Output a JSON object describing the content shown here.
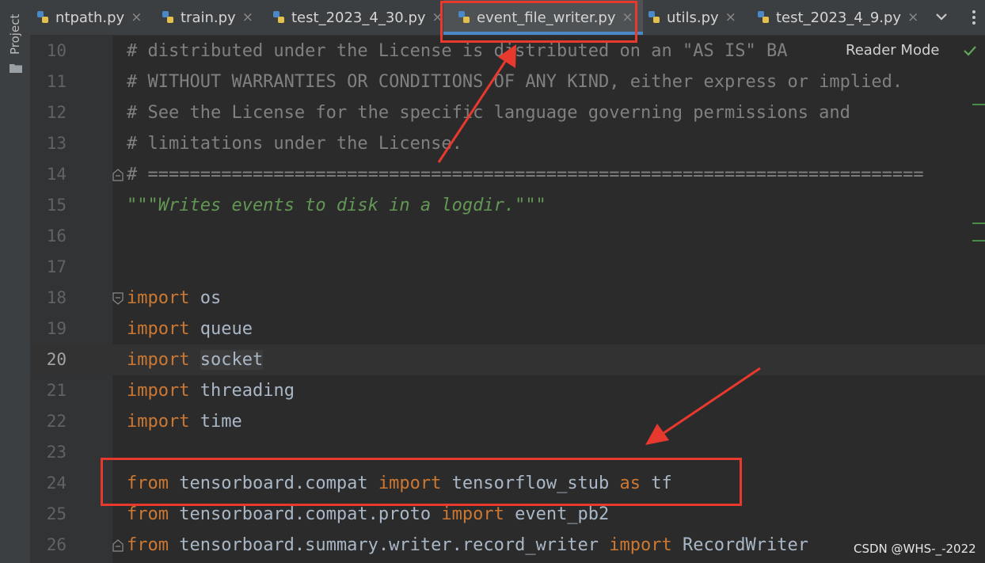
{
  "sidebar": {
    "project_label": "Project",
    "project_icon": "folder-icon"
  },
  "tabs": [
    {
      "label": "ntpath.py",
      "icon": "python-file-icon"
    },
    {
      "label": "train.py",
      "icon": "python-file-icon"
    },
    {
      "label": "test_2023_4_30.py",
      "icon": "python-file-icon"
    },
    {
      "label": "event_file_writer.py",
      "icon": "python-file-icon",
      "active": true
    },
    {
      "label": "utils.py",
      "icon": "python-file-icon"
    },
    {
      "label": "test_2023_4_9.py",
      "icon": "python-file-icon"
    }
  ],
  "tab_close_glyph": "×",
  "editor": {
    "reader_mode_label": "Reader Mode",
    "current_line": "20",
    "lines": [
      {
        "num": "10",
        "text": "# distributed under the License is distributed on an \"AS IS\" BA"
      },
      {
        "num": "11",
        "text": "# WITHOUT WARRANTIES OR CONDITIONS OF ANY KIND, either express or implied."
      },
      {
        "num": "12",
        "text": "# See the License for the specific language governing permissions and"
      },
      {
        "num": "13",
        "text": "# limitations under the License."
      },
      {
        "num": "14",
        "text": "# =========================================================================="
      },
      {
        "num": "15",
        "text": "\"\"\"Writes events to disk in a logdir.\"\"\""
      },
      {
        "num": "16",
        "text": ""
      },
      {
        "num": "17",
        "text": ""
      },
      {
        "num": "18",
        "kw": "import",
        "rest": " os"
      },
      {
        "num": "19",
        "kw": "import",
        "rest": " queue"
      },
      {
        "num": "20",
        "kw": "import",
        "rest": "socket"
      },
      {
        "num": "21",
        "kw": "import",
        "rest": " threading"
      },
      {
        "num": "22",
        "kw": "import",
        "rest": " time"
      },
      {
        "num": "23",
        "text": ""
      },
      {
        "num": "24",
        "kw": "from",
        "mod": " tensorboard.compat ",
        "kw2": "import",
        "rest2": " tensorflow_stub ",
        "kw3": "as",
        "rest3": " tf"
      },
      {
        "num": "25",
        "kw": "from",
        "mod": " tensorboard.compat.proto ",
        "kw2": "import",
        "rest2": " event_pb2"
      },
      {
        "num": "26",
        "kw": "from",
        "mod": " tensorboard.summary.writer.record_writer ",
        "kw2": "import",
        "rest2": " RecordWriter"
      }
    ]
  },
  "watermark": "CSDN @WHS-_-2022",
  "colors": {
    "annotation_red": "#e8392f",
    "keyword": "#cc7832",
    "comment": "#808080",
    "docstring": "#629755",
    "tab_underline": "#4a88c7"
  }
}
